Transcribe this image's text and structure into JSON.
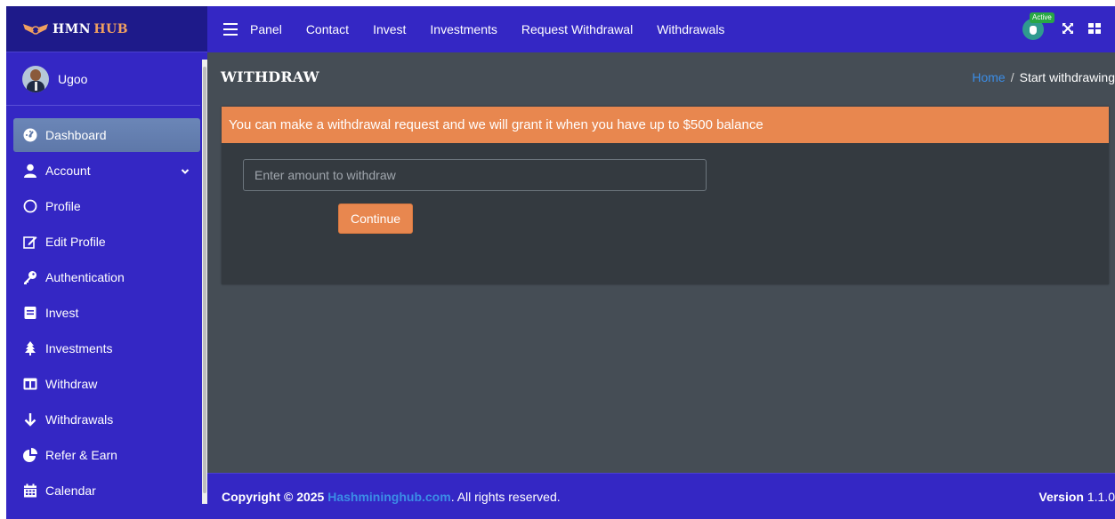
{
  "brand": {
    "name_part1": "HMN",
    "name_part2": "HUB"
  },
  "user": {
    "name": "Ugoo"
  },
  "sidebar": {
    "items": [
      {
        "label": "Dashboard",
        "icon": "dashboard-icon"
      },
      {
        "label": "Account",
        "icon": "user-icon"
      },
      {
        "label": "Profile",
        "icon": "circle-icon"
      },
      {
        "label": "Edit Profile",
        "icon": "edit-icon"
      },
      {
        "label": "Authentication",
        "icon": "key-icon"
      },
      {
        "label": "Invest",
        "icon": "book-icon"
      },
      {
        "label": "Investments",
        "icon": "tree-icon"
      },
      {
        "label": "Withdraw",
        "icon": "columns-icon"
      },
      {
        "label": "Withdrawals",
        "icon": "arrow-down-icon"
      },
      {
        "label": "Refer & Earn",
        "icon": "pie-chart-icon"
      },
      {
        "label": "Calendar",
        "icon": "calendar-icon"
      }
    ]
  },
  "topnav": {
    "links": [
      "Panel",
      "Contact",
      "Invest",
      "Investments",
      "Request Withdrawal",
      "Withdrawals"
    ],
    "status_badge": "Active"
  },
  "header": {
    "title": "WITHDRAW",
    "breadcrumb_home": "Home",
    "breadcrumb_sep": "/",
    "breadcrumb_current": "Start withdrawing"
  },
  "withdraw": {
    "alert": "You can make a withdrawal request and we will grant it when you have up to $500 balance",
    "amount_placeholder": "Enter amount to withdraw",
    "amount_value": "",
    "continue_label": "Continue"
  },
  "footer": {
    "copyright": "Copyright © 2025 ",
    "site": "Hashmininghub.com",
    "rest": ". All rights reserved.",
    "version_label": "Version",
    "version": "1.1.0"
  },
  "colors": {
    "primary": "#3427c4",
    "accent": "#e8874f",
    "content_bg": "#454d55",
    "card_bg": "#343a40",
    "link": "#3b8de6"
  }
}
